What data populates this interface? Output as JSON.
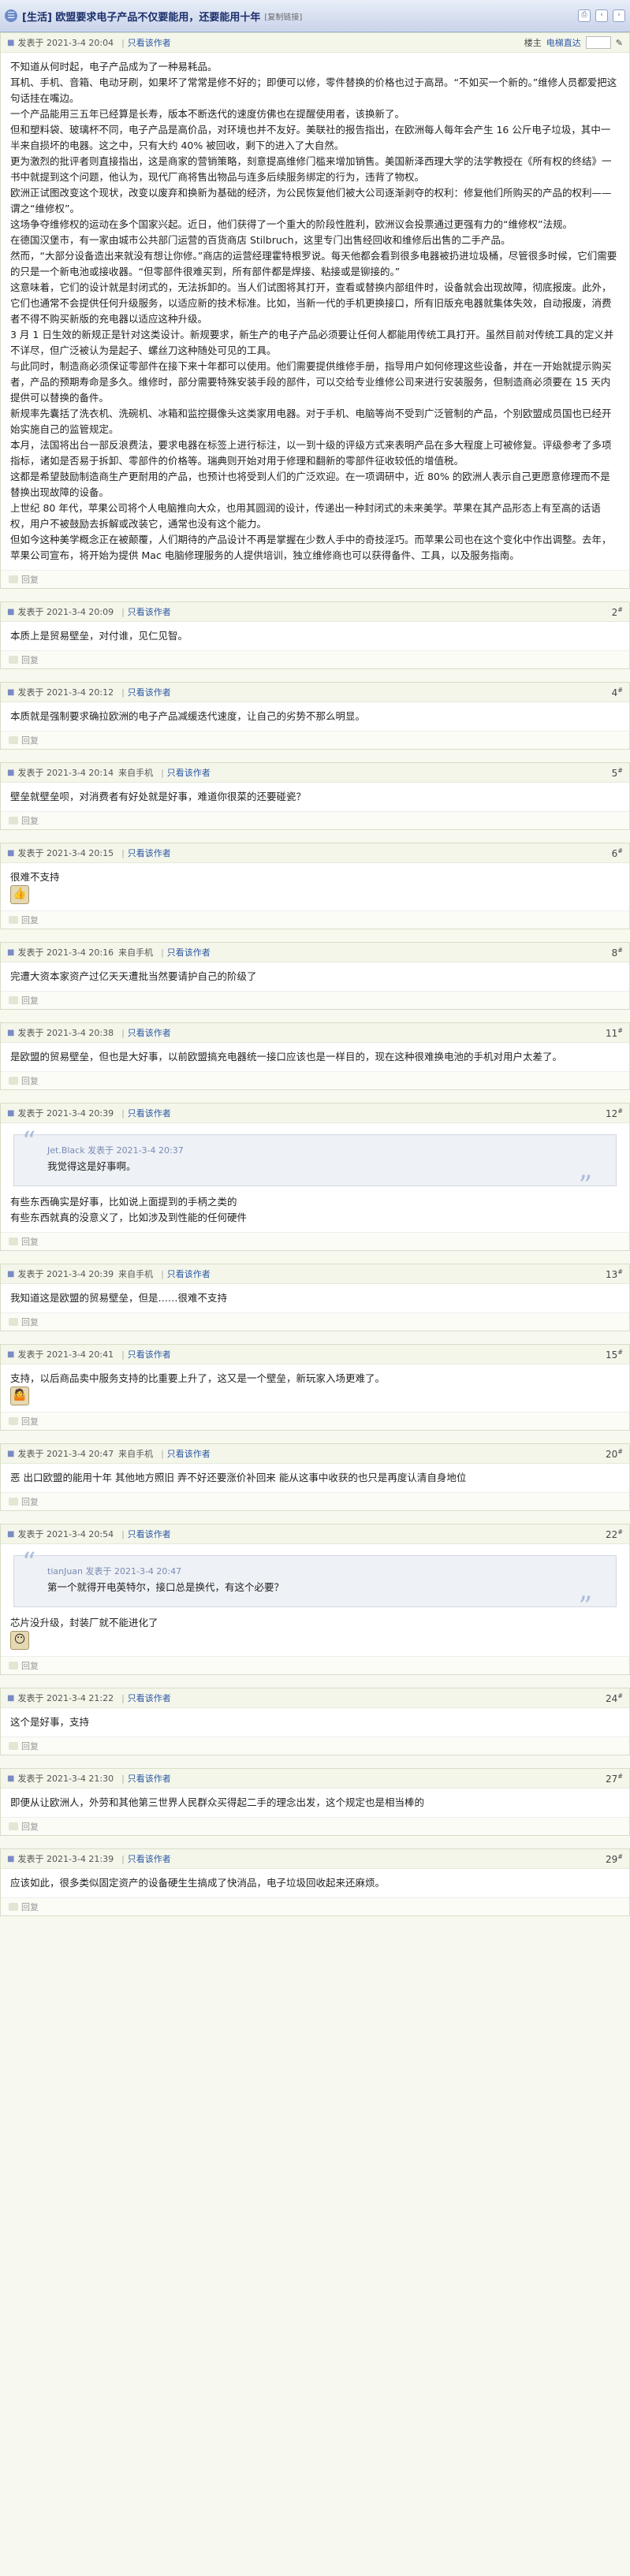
{
  "header": {
    "title": "[生活] 欧盟要求电子产品不仅要能用，还要能用十年",
    "copy_link": "[复制链接]"
  },
  "meta_labels": {
    "only_author": "只看该作者",
    "mobile": "来自手机",
    "louzhu": "楼主",
    "electric": "电梯直达",
    "reply": "回复"
  },
  "posts": [
    {
      "date": "发表于 2021-3-4 20:04",
      "floor": "",
      "body": [
        "不知道从何时起，电子产品成为了一种易耗品。",
        "耳机、手机、音箱、电动牙刷，如果坏了常常是修不好的；即便可以修，零件替换的价格也过于高昂。“不如买一个新的。”维修人员都爱把这句话挂在嘴边。",
        "一个产品能用三五年已经算是长寿，版本不断迭代的速度仿佛也在提醒使用者，该换新了。",
        "但和塑料袋、玻璃杯不同，电子产品是高价品，对环境也并不友好。美联社的报告指出，在欧洲每人每年会产生 16 公斤电子垃圾，其中一半来自损坏的电器。这之中，只有大约 40% 被回收，剩下的进入了大自然。",
        "更为激烈的批评者则直接指出，这是商家的营销策略，刻意提高维修门槛来增加销售。美国新泽西理大学的法学教授在《所有权的终结》一书中就提到这个问题，他认为，现代厂商将售出物品与连多后续服务绑定的行为，违背了物权。",
        "欧洲正试图改变这个现状，改变以废弃和换新为基础的经济，为公民恢复他们被大公司逐渐剥夺的权利：修复他们所购买的产品的权利——谓之“维修权”。",
        "这场争夺维修权的运动在多个国家兴起。近日，他们获得了一个重大的阶段性胜利，欧洲议会投票通过更强有力的“维修权”法规。",
        "在德国汉堡市，有一家由城市公共部门运营的百货商店 Stilbruch，这里专门出售经回收和维修后出售的二手产品。",
        "然而，“大部分设备造出来就没有想让你修。”商店的运营经理霍特根罗说。每天他都会看到很多电器被扔进垃圾桶，尽管很多时候，它们需要的只是一个新电池或接收器。“但零部件很难买到，所有部件都是焊接、粘接或是铆接的。”",
        "这意味着，它们的设计就是封闭式的，无法拆卸的。当人们试图将其打开，查看或替换内部组件时，设备就会出现故障，彻底报废。此外，它们也通常不会提供任何升级服务，以适应新的技术标准。比如，当新一代的手机更换接口，所有旧版充电器就集体失效，自动报废，消费者不得不购买新版的充电器以适应这种升级。",
        "3 月 1 日生效的新规正是针对这类设计。新规要求，新生产的电子产品必须要让任何人都能用传统工具打开。虽然目前对传统工具的定义并不详尽，但广泛被认为是起子、螺丝刀这种随处可见的工具。",
        "与此同时，制造商必须保证零部件在接下来十年都可以使用。他们需要提供维修手册，指导用户如何修理这些设备，并在一开始就提示购买者，产品的预期寿命是多久。维修时，部分需要特殊安装手段的部件，可以交给专业维修公司来进行安装服务，但制造商必须要在 15 天内提供可以替换的备件。",
        "新规率先囊括了洗衣机、洗碗机、冰箱和监控摄像头这类家用电器。对于手机、电脑等尚不受到广泛管制的产品，个别欧盟成员国也已经开始实施自己的监管规定。",
        "本月，法国将出台一部反浪费法，要求电器在标签上进行标注，以一到十级的评级方式来表明产品在多大程度上可被修复。评级参考了多项指标，诸如是否易于拆卸、零部件的价格等。瑞典则开始对用于修理和翻新的零部件征收较低的增值税。",
        "这都是希望鼓励制造商生产更耐用的产品，也预计也将受到人们的广泛欢迎。在一项调研中，近 80% 的欧洲人表示自己更愿意修理而不是替换出现故障的设备。",
        "上世纪 80 年代，苹果公司将个人电脑推向大众，也用其圆润的设计，传递出一种封闭式的未来美学。苹果在其产品形态上有至高的话语权，用户不被鼓励去拆解或改装它，通常也没有这个能力。",
        "但如今这种美学概念正在被颠覆，人们期待的产品设计不再是掌握在少数人手中的奇技淫巧。而苹果公司也在这个变化中作出调整。去年，苹果公司宣布，将开始为提供 Mac 电脑修理服务的人提供培训，独立维修商也可以获得备件、工具，以及服务指南。"
      ],
      "quote_author": "",
      "quote_text": "",
      "emoji": ""
    },
    {
      "date": "发表于 2021-3-4 20:09",
      "floor": "2",
      "body": [
        "本质上是贸易壁垒，对付谁，见仁见智。"
      ],
      "quote_author": "",
      "quote_text": "",
      "emoji": ""
    },
    {
      "date": "发表于 2021-3-4 20:12",
      "floor": "4",
      "body": [
        "本质就是强制要求确拉欧洲的电子产品减缓迭代速度，让自己的劣势不那么明显。"
      ],
      "quote_author": "",
      "quote_text": "",
      "emoji": ""
    },
    {
      "date": "发表于 2021-3-4 20:14",
      "floor": "5",
      "mobile": true,
      "body": [
        "壁垒就壁垒呗，对消费者有好处就是好事，难道你很菜的还要碰瓷？"
      ],
      "quote_author": "",
      "quote_text": "",
      "emoji": ""
    },
    {
      "date": "发表于 2021-3-4 20:15",
      "floor": "6",
      "body": [
        "很难不支持"
      ],
      "quote_author": "",
      "quote_text": "",
      "emoji": "👍"
    },
    {
      "date": "发表于 2021-3-4 20:16",
      "floor": "8",
      "mobile": true,
      "body": [
        "完遭大资本家资产过亿天天遭批当然要请护自己的阶级了"
      ],
      "quote_author": "",
      "quote_text": "",
      "emoji": ""
    },
    {
      "date": "发表于 2021-3-4 20:38",
      "floor": "11",
      "body": [
        "是欧盟的贸易壁垒，但也是大好事，以前欧盟搞充电器统一接口应该也是一样目的，现在这种很难换电池的手机对用户太差了。"
      ],
      "quote_author": "",
      "quote_text": "",
      "emoji": ""
    },
    {
      "date": "发表于 2021-3-4 20:39",
      "floor": "12",
      "body": [
        "有些东西确实是好事，比如说上面提到的手柄之类的",
        "有些东西就真的没意义了，比如涉及到性能的任何硬件"
      ],
      "quote_author": "Jet.Black 发表于 2021-3-4 20:37",
      "quote_text": "我觉得这是好事啊。",
      "emoji": ""
    },
    {
      "date": "发表于 2021-3-4 20:39",
      "floor": "13",
      "mobile": true,
      "body": [
        "我知道这是欧盟的贸易壁垒，但是……很难不支持"
      ],
      "quote_author": "",
      "quote_text": "",
      "emoji": ""
    },
    {
      "date": "发表于 2021-3-4 20:41",
      "floor": "15",
      "body": [
        "支持，以后商品卖中服务支持的比重要上升了，这又是一个壁垒，新玩家入场更难了。"
      ],
      "quote_author": "",
      "quote_text": "",
      "emoji": "🤷"
    },
    {
      "date": "发表于 2021-3-4 20:47",
      "floor": "20",
      "mobile": true,
      "body": [
        "恶 出口欧盟的能用十年 其他地方照旧 弄不好还要涨价补回来 能从这事中收获的也只是再度认清自身地位"
      ],
      "quote_author": "",
      "quote_text": "",
      "emoji": ""
    },
    {
      "date": "发表于 2021-3-4 20:54",
      "floor": "22",
      "body": [
        "芯片没升级，封装厂就不能进化了"
      ],
      "quote_author": "tianJuan 发表于 2021-3-4 20:47",
      "quote_text": "第一个就得开电英特尔，接口总是换代，有这个必要？",
      "emoji": "😶"
    },
    {
      "date": "发表于 2021-3-4 21:22",
      "floor": "24",
      "body": [
        "这个是好事，支持"
      ],
      "quote_author": "",
      "quote_text": "",
      "emoji": ""
    },
    {
      "date": "发表于 2021-3-4 21:30",
      "floor": "27",
      "body": [
        "即便从让欧洲人，外劳和其他第三世界人民群众买得起二手的理念出发，这个规定也是相当棒的"
      ],
      "quote_author": "",
      "quote_text": "",
      "emoji": ""
    },
    {
      "date": "发表于 2021-3-4 21:39",
      "floor": "29",
      "body": [
        "应该如此，很多类似固定资产的设备硬生生搞成了快消品，电子垃圾回收起来还麻烦。"
      ],
      "quote_author": "",
      "quote_text": "",
      "emoji": ""
    }
  ]
}
